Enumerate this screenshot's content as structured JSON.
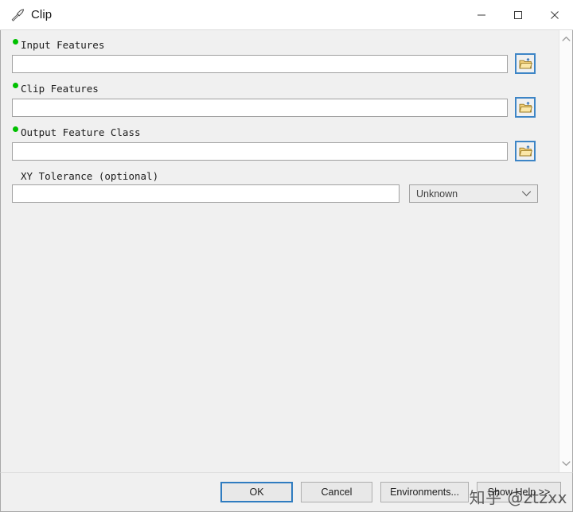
{
  "window": {
    "title": "Clip",
    "icon": "hammer-icon",
    "controls": {
      "minimize": "–",
      "maximize": "□",
      "close": "×"
    }
  },
  "form": {
    "fields": [
      {
        "label": "Input Features",
        "required": true,
        "value": "",
        "placeholder": "",
        "browse_icon": "open-folder-icon"
      },
      {
        "label": "Clip Features",
        "required": true,
        "value": "",
        "placeholder": "",
        "browse_icon": "open-folder-icon"
      },
      {
        "label": "Output Feature Class",
        "required": true,
        "value": "",
        "placeholder": "",
        "browse_icon": "open-folder-icon"
      }
    ],
    "tolerance": {
      "label": "XY Tolerance (optional)",
      "required": false,
      "value": "",
      "placeholder": "",
      "unit_selected": "Unknown",
      "unit_options": [
        "Unknown"
      ]
    }
  },
  "scrollbar": {
    "up_icon": "chevron-up-icon",
    "down_icon": "chevron-down-icon"
  },
  "footer": {
    "ok": "OK",
    "cancel": "Cancel",
    "environments": "Environments...",
    "show_help": "Show Help >>"
  },
  "watermark": {
    "text": "知乎 @ztzxx"
  },
  "colors": {
    "required_dot": "#00c000",
    "focus_border": "#2f7cc0",
    "browse_border": "#3d85c6",
    "dialog_bg": "#f0f0f0",
    "input_bg": "#ffffff"
  }
}
